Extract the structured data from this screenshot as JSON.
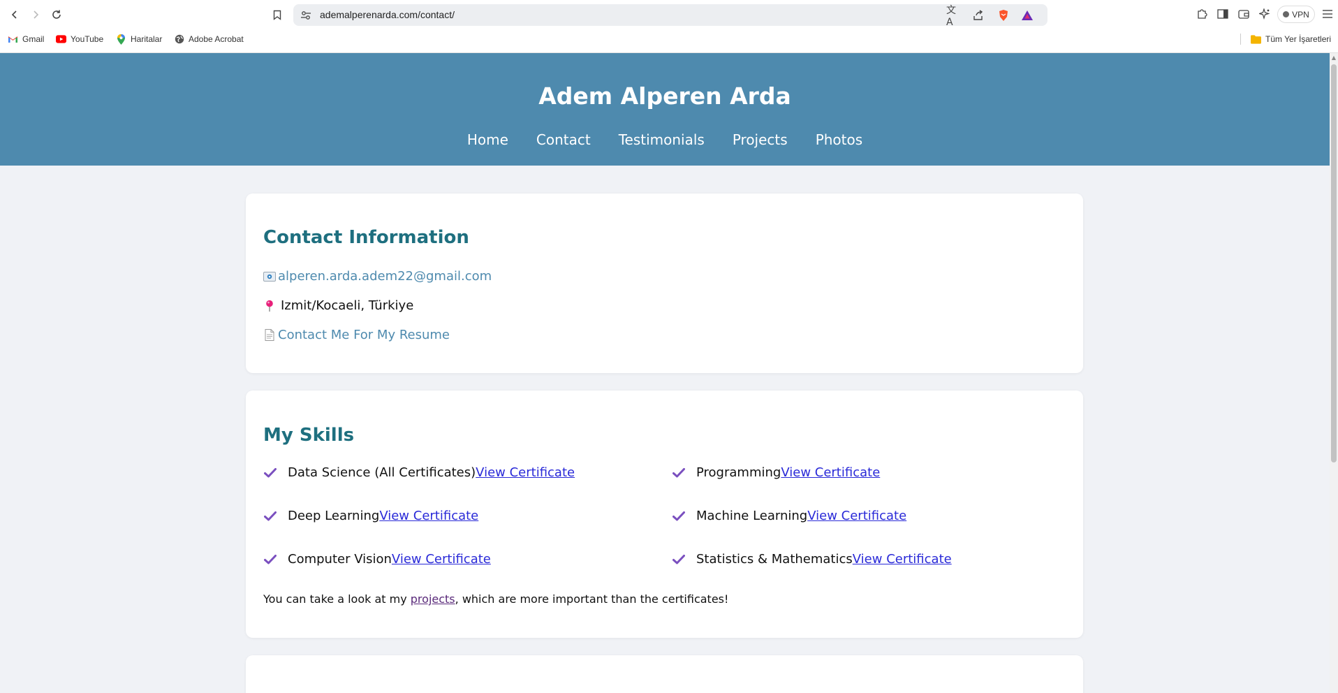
{
  "browser": {
    "url": "ademalperenarda.com/contact/",
    "vpn_label": "VPN",
    "bookmarks": [
      {
        "label": "Gmail",
        "icon": "gmail-icon"
      },
      {
        "label": "YouTube",
        "icon": "youtube-icon"
      },
      {
        "label": "Haritalar",
        "icon": "maps-icon"
      },
      {
        "label": "Adobe Acrobat",
        "icon": "globe-icon"
      }
    ],
    "all_bookmarks": "Tüm Yer İşaretleri"
  },
  "site": {
    "title": "Adem Alperen Arda",
    "nav": [
      "Home",
      "Contact",
      "Testimonials",
      "Projects",
      "Photos"
    ],
    "header_color": "#4e8aae"
  },
  "contact": {
    "heading": "Contact Information",
    "email": "alperen.arda.adem22@gmail.com",
    "location": "Izmit/Kocaeli, Türkiye",
    "resume_link": "Contact Me For My Resume"
  },
  "skills": {
    "heading": "My Skills",
    "items": [
      {
        "name": "Data Science (All Certificates)",
        "link": "View Certificate"
      },
      {
        "name": "Programming",
        "link": "View Certificate"
      },
      {
        "name": "Deep Learning",
        "link": "View Certificate"
      },
      {
        "name": "Machine Learning",
        "link": "View Certificate"
      },
      {
        "name": "Computer Vision",
        "link": "View Certificate"
      },
      {
        "name": "Statistics & Mathematics",
        "link": "View Certificate"
      }
    ],
    "note_before": "You can take a look at my ",
    "note_link": "projects",
    "note_after": ", which are more important than the certificates!"
  }
}
